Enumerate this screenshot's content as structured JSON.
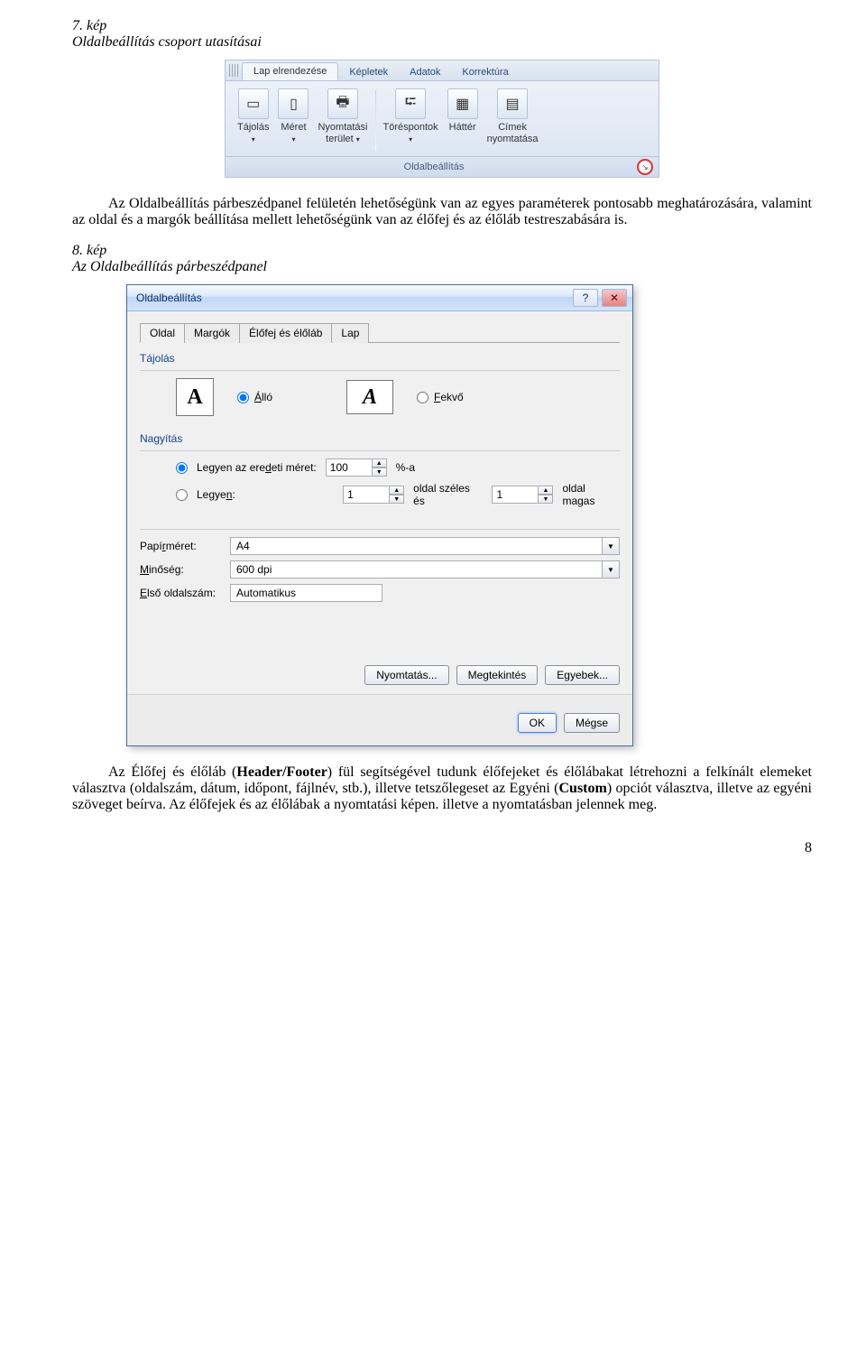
{
  "doc": {
    "fig7_label": "7. kép",
    "fig7_caption": "Oldalbeállítás csoport utasításai",
    "para1": "Az Oldalbeállítás párbeszédpanel felületén lehetőségünk van az egyes paraméterek pontosabb meghatározására, valamint az oldal és a margók beállítása mellett lehetőségünk van az élőfej és az élőláb testreszabására is.",
    "fig8_label": "8. kép",
    "fig8_caption": "Az Oldalbeállítás párbeszédpanel",
    "para2_a": "Az Élőfej és élőláb (",
    "para2_bold": "Header/Footer",
    "para2_b": ") fül segítségével tudunk élőfejeket és élőlábakat létrehozni a felkínált elemeket választva (oldalszám, dátum, időpont, fájlnév, stb.), illetve tetszőlegeset az Egyéni (",
    "para2_bold2": "Custom",
    "para2_c": ") opciót választva, illetve az egyéni szöveget beírva. Az élőfejek és az élőlábak a nyomtatási képen. illetve a nyomtatásban jelennek meg.",
    "page_number": "8"
  },
  "ribbon": {
    "tabs": {
      "active": "Lap elrendezése",
      "t2": "Képletek",
      "t3": "Adatok",
      "t4": "Korrektúra"
    },
    "items": {
      "t0": "Tájolás",
      "t1": "Méret",
      "t2a": "Nyomtatási",
      "t2b": "terület",
      "t3": "Töréspontok",
      "t4": "Háttér",
      "t5a": "Címek",
      "t5b": "nyomtatása"
    },
    "group": "Oldalbeállítás"
  },
  "dlg": {
    "title": "Oldalbeállítás",
    "tabs": {
      "t0": "Oldal",
      "t1": "Margók",
      "t2": "Élőfej és élőláb",
      "t3": "Lap"
    },
    "orientation": {
      "label": "Tájolás",
      "portrait": "Álló",
      "landscape": "Fekvő"
    },
    "zoom": {
      "label": "Nagyítás",
      "opt1": "Legyen az eredeti méret:",
      "val1": "100",
      "suffix1": "%-a",
      "opt2": "Legyen:",
      "wide": "1",
      "wide_suffix": "oldal széles és",
      "tall": "1",
      "tall_suffix": "oldal magas"
    },
    "paper": {
      "label": "Papírméret:",
      "value": "A4"
    },
    "quality": {
      "label": "Minőség:",
      "value": "600 dpi"
    },
    "first": {
      "label": "Első oldalszám:",
      "value": "Automatikus"
    },
    "buttons": {
      "print": "Nyomtatás...",
      "preview": "Megtekintés",
      "options": "Egyebek...",
      "ok": "OK",
      "cancel": "Mégse"
    }
  }
}
